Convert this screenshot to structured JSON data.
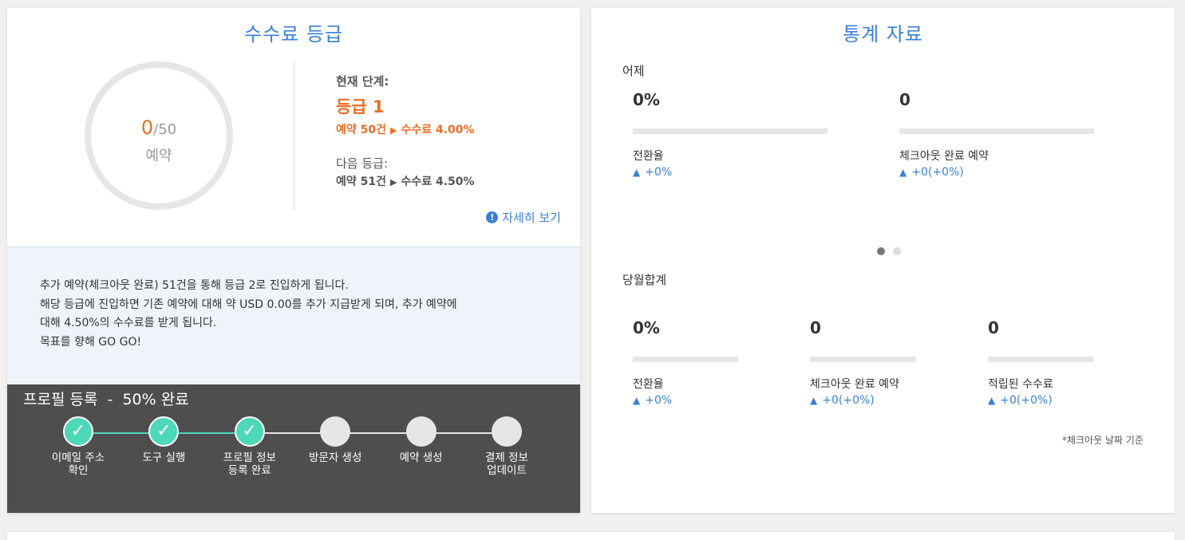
{
  "commission_tier": {
    "title": "수수료 등급",
    "gauge": {
      "current": "0",
      "total": "/50",
      "unit": "예약"
    },
    "current_label": "현재 단계:",
    "current_tier": "등급 1",
    "current_bookings": "예약 50건",
    "current_rate": "수수료 4.00%",
    "next_label": "다음 등급:",
    "next_bookings": "예약 51건",
    "next_rate": "수수료 4.50%",
    "details_link": "자세히 보기",
    "colors": {
      "accent_orange": "#e86e25",
      "link_blue": "#3a7fd6"
    }
  },
  "info": {
    "lines": [
      "추가 예약(체크아웃 완료) 51건을 통해 등급 2로 진입하게 됩니다.",
      "해당 등급에 진입하면 기존 예약에 대해 약 USD 0.00를 추가 지급받게 되며, 추가 예약에",
      "대해 4.50%의 수수료를 받게 됩니다.",
      "목표를 향해 GO GO!"
    ]
  },
  "profile": {
    "title": "프로필 등록  -  50% 완료",
    "check_glyph": "✓",
    "completion_percent": 50,
    "steps": [
      {
        "label": "이메일 주소 확인",
        "done": true
      },
      {
        "label": "도구 실행",
        "done": true
      },
      {
        "label": "프로필 정보 등록 완료",
        "done": true
      },
      {
        "label": "방문자 생성",
        "done": false
      },
      {
        "label": "예약 생성",
        "done": false
      },
      {
        "label": "결제 정보 업데이트",
        "done": false
      }
    ],
    "colors": {
      "done": "#4dd9b9",
      "pending": "#e6e6e6"
    }
  },
  "stats": {
    "title": "통계 자료",
    "yesterday": {
      "label": "어제",
      "items": [
        {
          "value": "0%",
          "label": "전환율",
          "change": "+0%"
        },
        {
          "value": "0",
          "label": "체크아웃 완료 예약",
          "change": "+0(+0%)"
        }
      ]
    },
    "month": {
      "label": "당월합계",
      "items": [
        {
          "value": "0%",
          "label": "전환율",
          "change": "+0%"
        },
        {
          "value": "0",
          "label": "체크아웃 완료 예약",
          "change": "+0(+0%)"
        },
        {
          "value": "0",
          "label": "적립된 수수료",
          "change": "+0(+0%)"
        }
      ]
    },
    "carousel": {
      "pages": 2,
      "active": 1
    },
    "footnote": "*체크아웃 날짜 기준",
    "up_icon": "▲"
  }
}
